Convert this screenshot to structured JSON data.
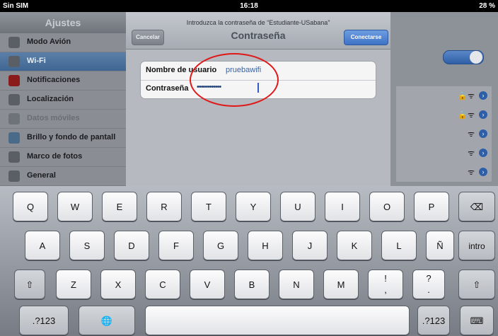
{
  "status": {
    "carrier": "Sin SIM",
    "wifi": "ᯤ",
    "time": "16:18",
    "battery": "28 %"
  },
  "settings": {
    "title": "Ajustes",
    "items": [
      {
        "label": "Modo Avión",
        "icon": "airplane-icon"
      },
      {
        "label": "Wi-Fi",
        "icon": "wifi-icon"
      },
      {
        "label": "Notificaciones",
        "icon": "notifications-icon"
      },
      {
        "label": "Localización",
        "icon": "location-icon"
      },
      {
        "label": "Datos móviles",
        "icon": "cellular-icon"
      },
      {
        "label": "Brillo y fondo de pantall",
        "icon": "brightness-icon"
      },
      {
        "label": "Marco de fotos",
        "icon": "photo-frame-icon"
      },
      {
        "label": "General",
        "icon": "gear-icon"
      }
    ]
  },
  "modal": {
    "prompt": "Introduzca la contraseña de “Estudiante-USabana”",
    "title": "Contraseña",
    "cancel": "Cancelar",
    "connect": "Conectarse",
    "username_label": "Nombre de usuario",
    "username_value": "pruebawifi",
    "password_label": "Contraseña",
    "password_value": "••••••••••••"
  },
  "keyboard": {
    "row1": [
      "Q",
      "W",
      "E",
      "R",
      "T",
      "Y",
      "U",
      "I",
      "O",
      "P",
      "⌫"
    ],
    "row2": [
      "A",
      "S",
      "D",
      "F",
      "G",
      "H",
      "J",
      "K",
      "L",
      "Ñ",
      "intro"
    ],
    "row3": [
      "⇧",
      "Z",
      "X",
      "C",
      "V",
      "B",
      "N",
      "M",
      "!\n,",
      "?\n.",
      "⇧"
    ],
    "row4": [
      ".?123",
      "🌐",
      "",
      ".?123",
      "⌨"
    ]
  },
  "colors": {
    "annotation": "#e01818",
    "accent": "#3e72c6"
  }
}
